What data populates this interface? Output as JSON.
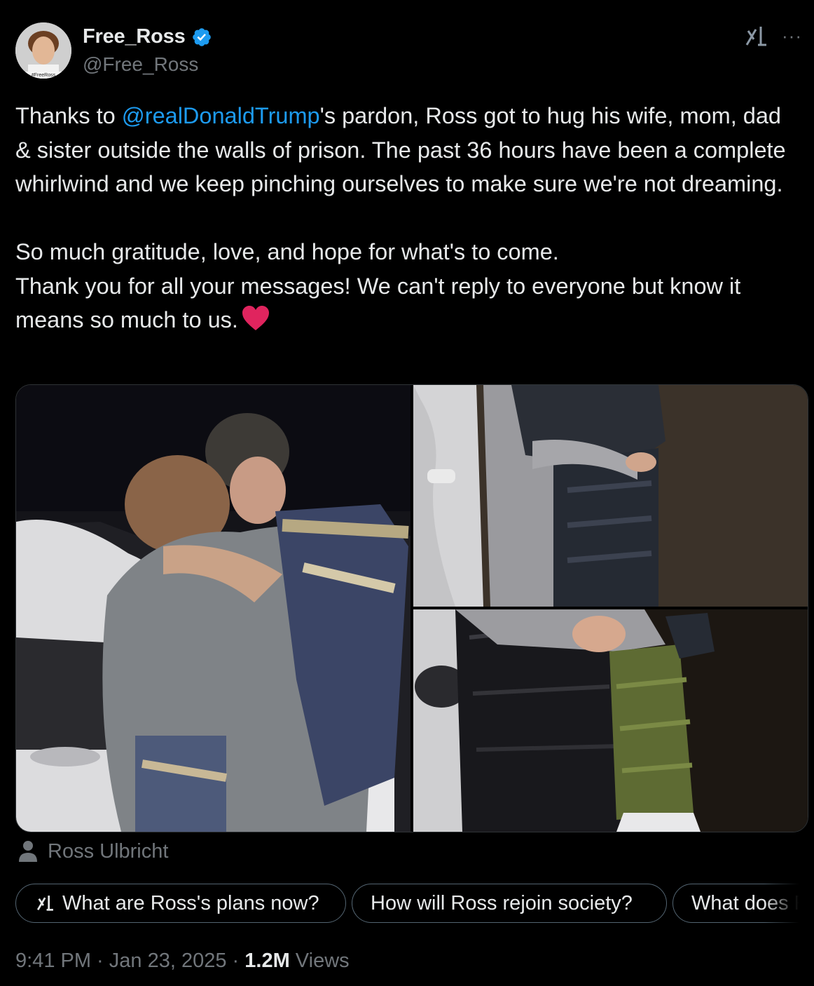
{
  "author": {
    "display_name": "Free_Ross",
    "handle": "@Free_Ross",
    "verified": true,
    "avatar_caption": "#FreeRoss"
  },
  "header_icons": {
    "grok": "grok-icon",
    "more": "···"
  },
  "tweet": {
    "p1_before": "Thanks to ",
    "mention": "@realDonaldTrump",
    "p1_after": "'s pardon, Ross got to hug his wife, mom, dad & sister outside the walls of prison. The past 36 hours have been a complete whirlwind and we keep pinching ourselves to make sure we're not dreaming.",
    "p2": "So much gratitude, love, and hope for what's to come.",
    "p3": "Thank you for all your messages! We can't reply to everyone but know it means so much to us.",
    "emoji": "heart-emoji"
  },
  "media_tag": {
    "name": "Ross Ulbricht"
  },
  "grok_prompts": [
    {
      "label": "What are Ross's plans now?"
    },
    {
      "label": "How will Ross rejoin society?"
    },
    {
      "label": "What does R"
    }
  ],
  "meta": {
    "time": "9:41 PM",
    "sep": " · ",
    "date": "Jan 23, 2025",
    "views_count": "1.2M",
    "views_label": " Views"
  },
  "colors": {
    "background": "#000000",
    "text": "#e7e9ea",
    "secondary": "#71767b",
    "link": "#1d9bf0",
    "verified": "#1d9bf0",
    "heart": "#e0245e"
  }
}
